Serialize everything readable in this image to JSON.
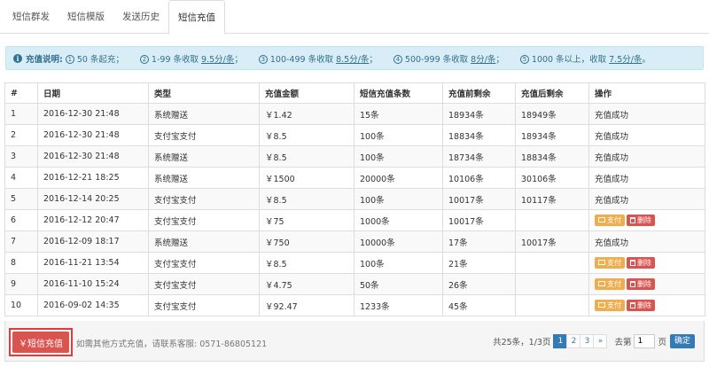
{
  "tabs": [
    {
      "label": "短信群发",
      "active": false
    },
    {
      "label": "短信模版",
      "active": false
    },
    {
      "label": "发送历史",
      "active": false
    },
    {
      "label": "短信充值",
      "active": true
    }
  ],
  "info": {
    "label": "充值说明:",
    "items": [
      {
        "num": "1",
        "text": "50 条起充；",
        "price": ""
      },
      {
        "num": "2",
        "text": "1-99 条收取 ",
        "price": "9.5分/条"
      },
      {
        "num": "3",
        "text": "100-499 条收取 ",
        "price": "8.5分/条"
      },
      {
        "num": "4",
        "text": "500-999 条收取 ",
        "price": "8分/条"
      },
      {
        "num": "5",
        "text": "1000 条以上，收取 ",
        "price": "7.5分/条"
      }
    ],
    "end": "。"
  },
  "table": {
    "headers": [
      "#",
      "日期",
      "类型",
      "充值金额",
      "短信充值条数",
      "充值前剩余",
      "充值后剩余",
      "操作"
    ],
    "rows": [
      [
        "1",
        "2016-12-30 21:48",
        "系统赠送",
        "￥1.42",
        "15条",
        "18934条",
        "18949条",
        "充值成功"
      ],
      [
        "2",
        "2016-12-30 21:48",
        "支付宝支付",
        "￥8.5",
        "100条",
        "18834条",
        "18934条",
        "充值成功"
      ],
      [
        "3",
        "2016-12-30 21:48",
        "系统赠送",
        "￥8.5",
        "100条",
        "18734条",
        "18834条",
        "充值成功"
      ],
      [
        "4",
        "2016-12-21 18:25",
        "系统赠送",
        "￥1500",
        "20000条",
        "10106条",
        "30106条",
        "充值成功"
      ],
      [
        "5",
        "2016-12-14 20:25",
        "支付宝支付",
        "￥8.5",
        "100条",
        "10017条",
        "10117条",
        "充值成功"
      ],
      [
        "6",
        "2016-12-12 20:47",
        "支付宝支付",
        "￥75",
        "1000条",
        "10017条",
        "",
        ""
      ],
      [
        "7",
        "2016-12-09 18:17",
        "系统赠送",
        "￥750",
        "10000条",
        "17条",
        "10017条",
        "充值成功"
      ],
      [
        "8",
        "2016-11-21 13:54",
        "支付宝支付",
        "￥8.5",
        "100条",
        "21条",
        "",
        ""
      ],
      [
        "9",
        "2016-11-10 15:24",
        "支付宝支付",
        "￥4.75",
        "50条",
        "26条",
        "",
        ""
      ],
      [
        "10",
        "2016-09-02 14:35",
        "支付宝支付",
        "￥92.47",
        "1233条",
        "45条",
        "",
        ""
      ]
    ],
    "pay_label": "支付",
    "delete_label": "删除"
  },
  "footer": {
    "recharge_label": "￥短信充值",
    "note": "如需其他方式充值，请联系客服: 0571-86805121",
    "pager": {
      "total": "共25条，1/3页",
      "pages": [
        "1",
        "2",
        "3",
        "»"
      ],
      "current": "1",
      "goto_label": "去第",
      "goto_value": "1",
      "page_suffix": "页",
      "confirm_label": "确定"
    }
  },
  "colors": {
    "info_bg": "#d9edf7",
    "pay_button": "#f0ad4e",
    "delete_button": "#d9534f",
    "primary": "#337ab7",
    "highlight_border": "#e43a3a"
  }
}
